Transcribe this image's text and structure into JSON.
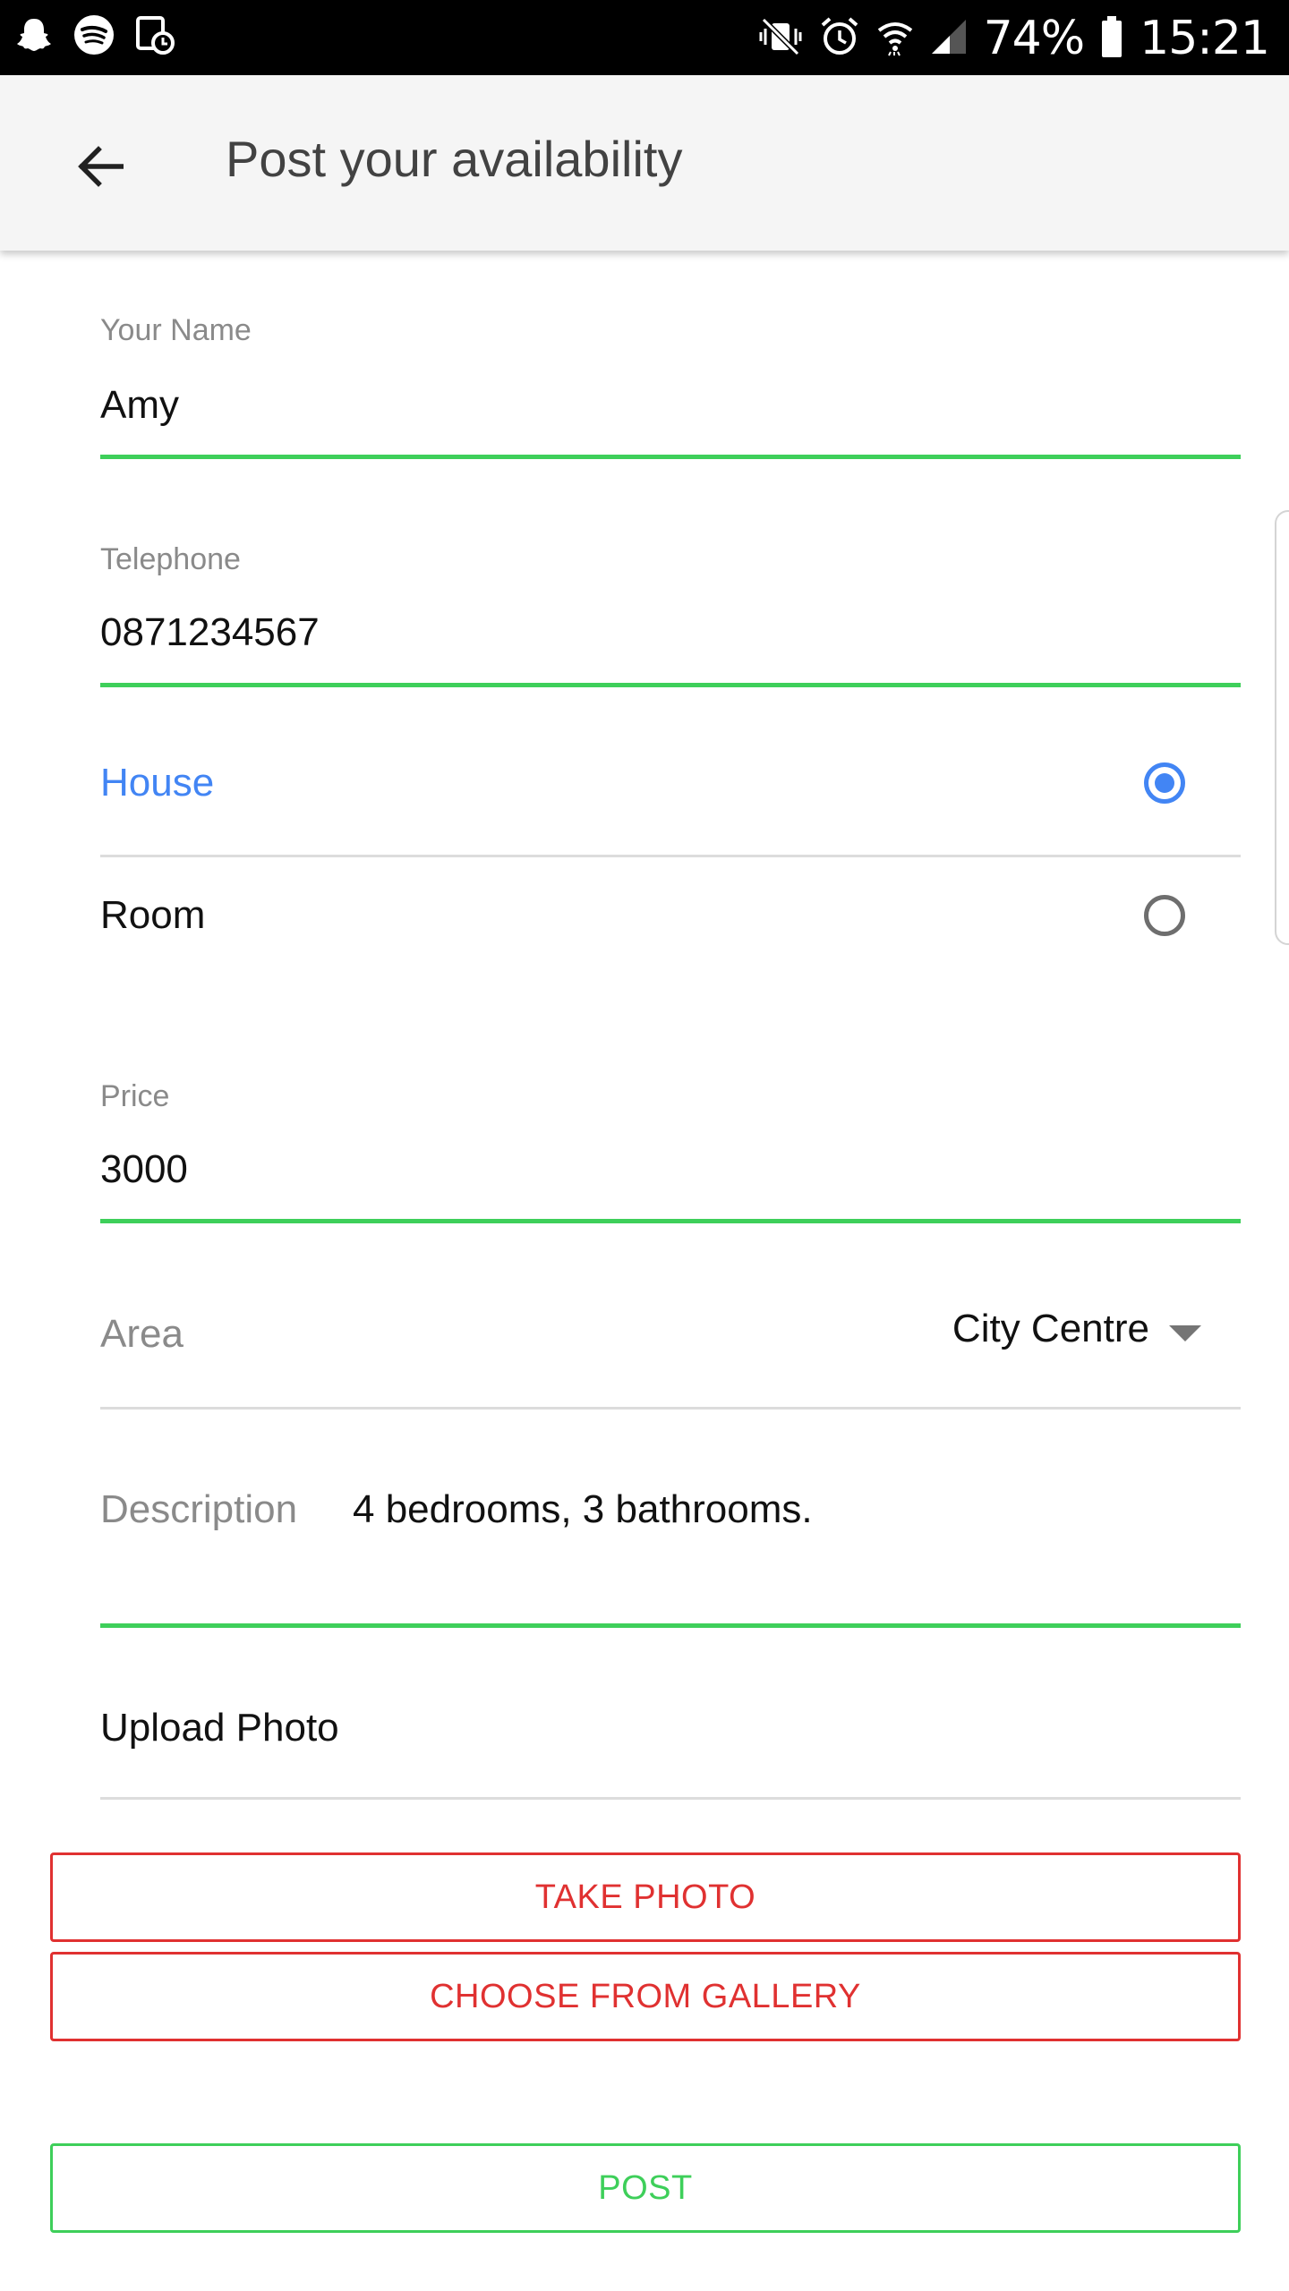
{
  "status_bar": {
    "left_icons": [
      "snapchat-icon",
      "spotify-icon",
      "screenshot-icon"
    ],
    "right_icons": [
      "vibrate-off-icon",
      "alarm-icon",
      "wifi-icon",
      "signal-icon",
      "battery-icon"
    ],
    "battery": "74%",
    "time": "15:21"
  },
  "app_bar": {
    "title": "Post your availability",
    "back_icon": "arrow-back-icon"
  },
  "form": {
    "name": {
      "label": "Your Name",
      "value": "Amy"
    },
    "telephone": {
      "label": "Telephone",
      "value": "0871234567"
    },
    "property_type": {
      "options": [
        {
          "label": "House",
          "selected": true
        },
        {
          "label": "Room",
          "selected": false
        }
      ]
    },
    "price": {
      "label": "Price",
      "value": "3000"
    },
    "area": {
      "label": "Area",
      "value": "City Centre"
    },
    "description": {
      "label": "Description",
      "value": "4 bedrooms, 3 bathrooms."
    },
    "upload_photo": {
      "label": "Upload Photo"
    }
  },
  "buttons": {
    "take_photo": "TAKE PHOTO",
    "choose_from_gallery": "CHOOSE FROM GALLERY",
    "post": "POST"
  },
  "colors": {
    "accent_green": "#3ecf5a",
    "accent_red": "#e03131",
    "accent_blue": "#4285f4",
    "app_bar_bg": "#f5f5f5",
    "status_bar_bg": "#000000"
  }
}
